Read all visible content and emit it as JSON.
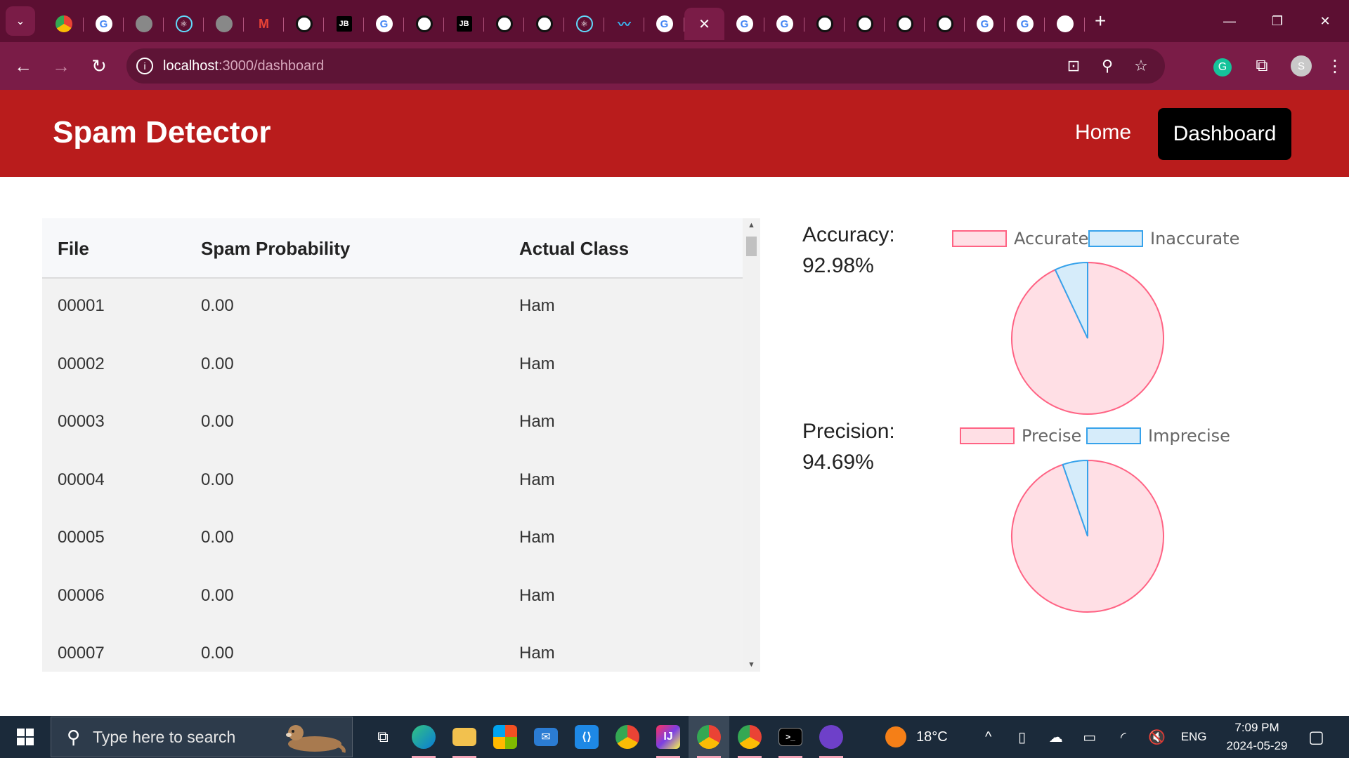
{
  "browser": {
    "url_host": "localhost",
    "url_path": ":3000/dashboard",
    "tab_favicons": [
      "multi",
      "g",
      "globe",
      "react",
      "globe",
      "gm",
      "gh",
      "jb",
      "g",
      "gh",
      "jb",
      "gh",
      "gh",
      "react",
      "tw",
      "g",
      "close",
      "g",
      "g",
      "gh",
      "gh",
      "gh",
      "gh",
      "g",
      "g",
      "chrome"
    ],
    "profile_initial": "S"
  },
  "app": {
    "brand": "Spam Detector",
    "nav": {
      "home": "Home",
      "dashboard": "Dashboard"
    }
  },
  "table": {
    "headers": [
      "File",
      "Spam Probability",
      "Actual Class"
    ],
    "rows": [
      {
        "file": "00001",
        "prob": "0.00",
        "cls": "Ham"
      },
      {
        "file": "00002",
        "prob": "0.00",
        "cls": "Ham"
      },
      {
        "file": "00003",
        "prob": "0.00",
        "cls": "Ham"
      },
      {
        "file": "00004",
        "prob": "0.00",
        "cls": "Ham"
      },
      {
        "file": "00005",
        "prob": "0.00",
        "cls": "Ham"
      },
      {
        "file": "00006",
        "prob": "0.00",
        "cls": "Ham"
      },
      {
        "file": "00007",
        "prob": "0.00",
        "cls": "Ham"
      }
    ]
  },
  "metrics": {
    "accuracy": {
      "label": "Accuracy:",
      "value": "92.98%"
    },
    "precision": {
      "label": "Precision:",
      "value": "94.69%"
    }
  },
  "chart_data": [
    {
      "type": "pie",
      "categories": [
        "Accurate",
        "Inaccurate"
      ],
      "values": [
        92.98,
        7.02
      ],
      "colors": [
        "#ff6384",
        "#36a2eb"
      ],
      "legend": "top"
    },
    {
      "type": "pie",
      "categories": [
        "Precise",
        "Imprecise"
      ],
      "values": [
        94.69,
        5.31
      ],
      "colors": [
        "#ff6384",
        "#36a2eb"
      ],
      "legend": "top"
    }
  ],
  "taskbar": {
    "search_placeholder": "Type here to search",
    "temperature": "18°C",
    "language": "ENG",
    "time": "7:09 PM",
    "date": "2024-05-29"
  },
  "colors": {
    "app_header": "#b91c1c",
    "browser_frame": "#7a1c47",
    "accent_pink": "#ff6384",
    "accent_blue": "#36a2eb"
  }
}
